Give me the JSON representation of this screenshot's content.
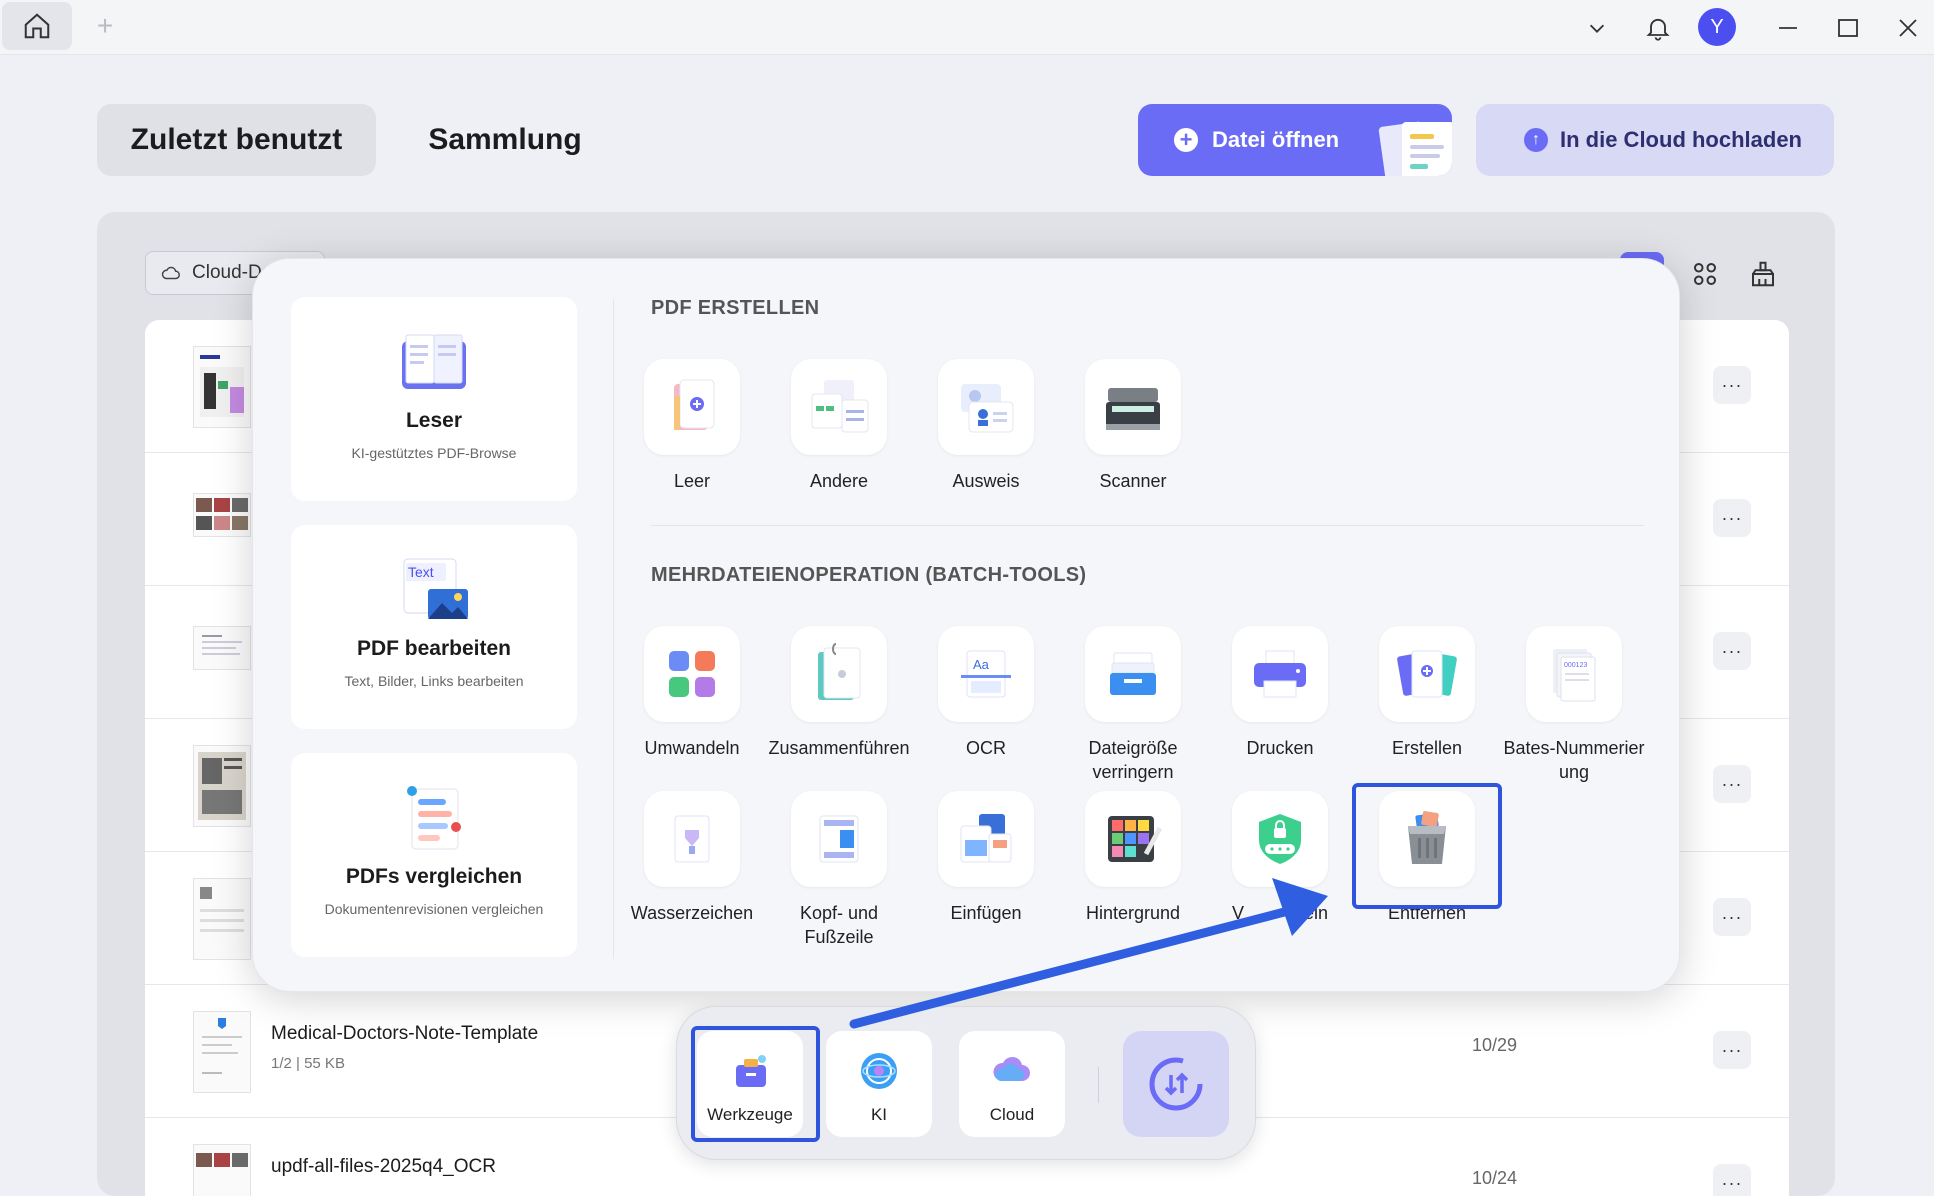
{
  "header": {
    "avatar_letter": "Y",
    "tab_recent": "Zuletzt benutzt",
    "tab_collection": "Sammlung",
    "open_file": "Datei öffnen",
    "upload_cloud": "In die Cloud hochladen"
  },
  "filters": {
    "cloud_drive": "Cloud-Da"
  },
  "feature_cards": [
    {
      "title": "Leser",
      "subtitle": "KI-gestütztes PDF-Browse"
    },
    {
      "title": "PDF bearbeiten",
      "subtitle": "Text, Bilder, Links bearbeiten",
      "icon_text": "Text"
    },
    {
      "title": "PDFs vergleichen",
      "subtitle": "Dokumentenrevisionen vergleichen"
    }
  ],
  "sections": {
    "create_title": "PDF ERSTELLEN",
    "batch_title": "MEHRDATEIENOPERATION (BATCH-TOOLS)"
  },
  "create_tools": [
    "Leer",
    "Andere",
    "Ausweis",
    "Scanner"
  ],
  "batch_tools": {
    "row1": [
      "Umwandeln",
      "Zusammenführen",
      "OCR",
      "Dateigröße verringern",
      "Drucken",
      "Erstellen",
      "Bates-Nummerier ung"
    ],
    "row2": [
      "Wasserzeichen",
      "Kopf- und Fußzeile",
      "Einfügen",
      "Hintergrund",
      "V",
      "eln",
      "Entfernen"
    ]
  },
  "files": [
    {
      "name": "Medical-Doctors-Note-Template",
      "meta": "1/2 | 55 KB",
      "date": "10/29"
    },
    {
      "name": "updf-all-files-2025q4_OCR",
      "meta": "",
      "date": "10/24"
    }
  ],
  "dock": {
    "tools": "Werkzeuge",
    "ai": "KI",
    "cloud": "Cloud"
  },
  "colors": {
    "accent": "#6b6cf6",
    "highlight": "#2f55dd",
    "arrow": "#2f5fe0"
  }
}
